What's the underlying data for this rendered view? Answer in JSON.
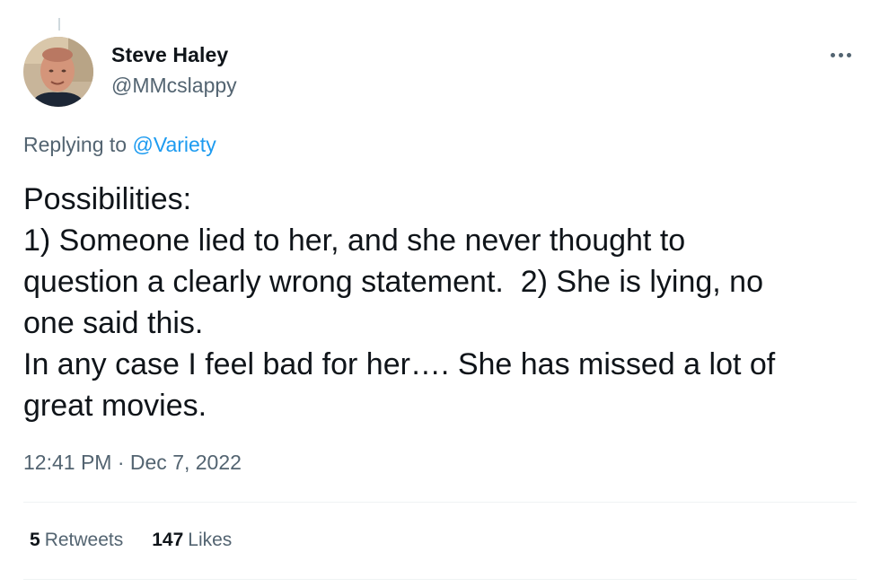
{
  "tweet": {
    "author_name": "Steve Haley",
    "author_handle": "@MMcslappy",
    "replying_prefix": "Replying to",
    "replying_to": "@Variety",
    "text_lines": [
      "Possibilities:",
      "1) Someone lied to her, and she never thought to",
      "question a clearly wrong statement.  2) She is lying, no",
      "one said this.",
      "In any case I feel bad for her…. She has missed a lot of",
      "great movies."
    ],
    "time": "12:41 PM",
    "separator": "·",
    "date": "Dec 7, 2022"
  },
  "stats": {
    "retweets_count": "5",
    "retweets_label": "Retweets",
    "likes_count": "147",
    "likes_label": "Likes"
  },
  "icons": {
    "more": "more-horizontal-icon",
    "avatar": "avatar"
  },
  "colors": {
    "link": "#1d9bf0",
    "secondary_text": "#536471",
    "primary_text": "#0f1419"
  }
}
